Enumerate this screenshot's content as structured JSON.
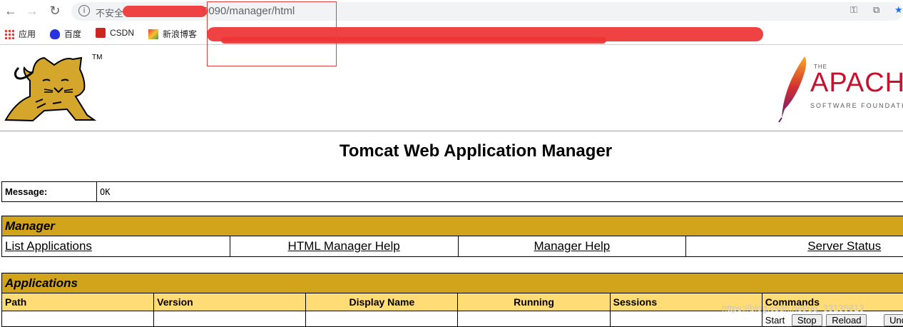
{
  "browser": {
    "insecure_label": "不安全",
    "url_suffix": "0090/manager/html",
    "bookmarks": [
      {
        "label": "应用"
      },
      {
        "label": "百度"
      },
      {
        "label": "CSDN"
      },
      {
        "label": "新浪博客"
      }
    ]
  },
  "page": {
    "tm": "TM",
    "apache_the": "THE",
    "apache_name": "APACHE",
    "apache_sub": "SOFTWARE FOUNDATION",
    "title": "Tomcat Web Application Manager"
  },
  "message": {
    "label": "Message:",
    "value": "OK"
  },
  "manager": {
    "title": "Manager",
    "links": [
      "List Applications",
      "HTML Manager Help",
      "Manager Help",
      "Server Status"
    ]
  },
  "applications": {
    "title": "Applications",
    "headers": [
      "Path",
      "Version",
      "Display Name",
      "Running",
      "Sessions",
      "Commands"
    ],
    "row_commands": {
      "start": "Start",
      "stop": "Stop",
      "reload": "Reload",
      "undeploy": "Undeploy"
    }
  },
  "watermark": "https://blog.csdn.net/qq_33135813"
}
